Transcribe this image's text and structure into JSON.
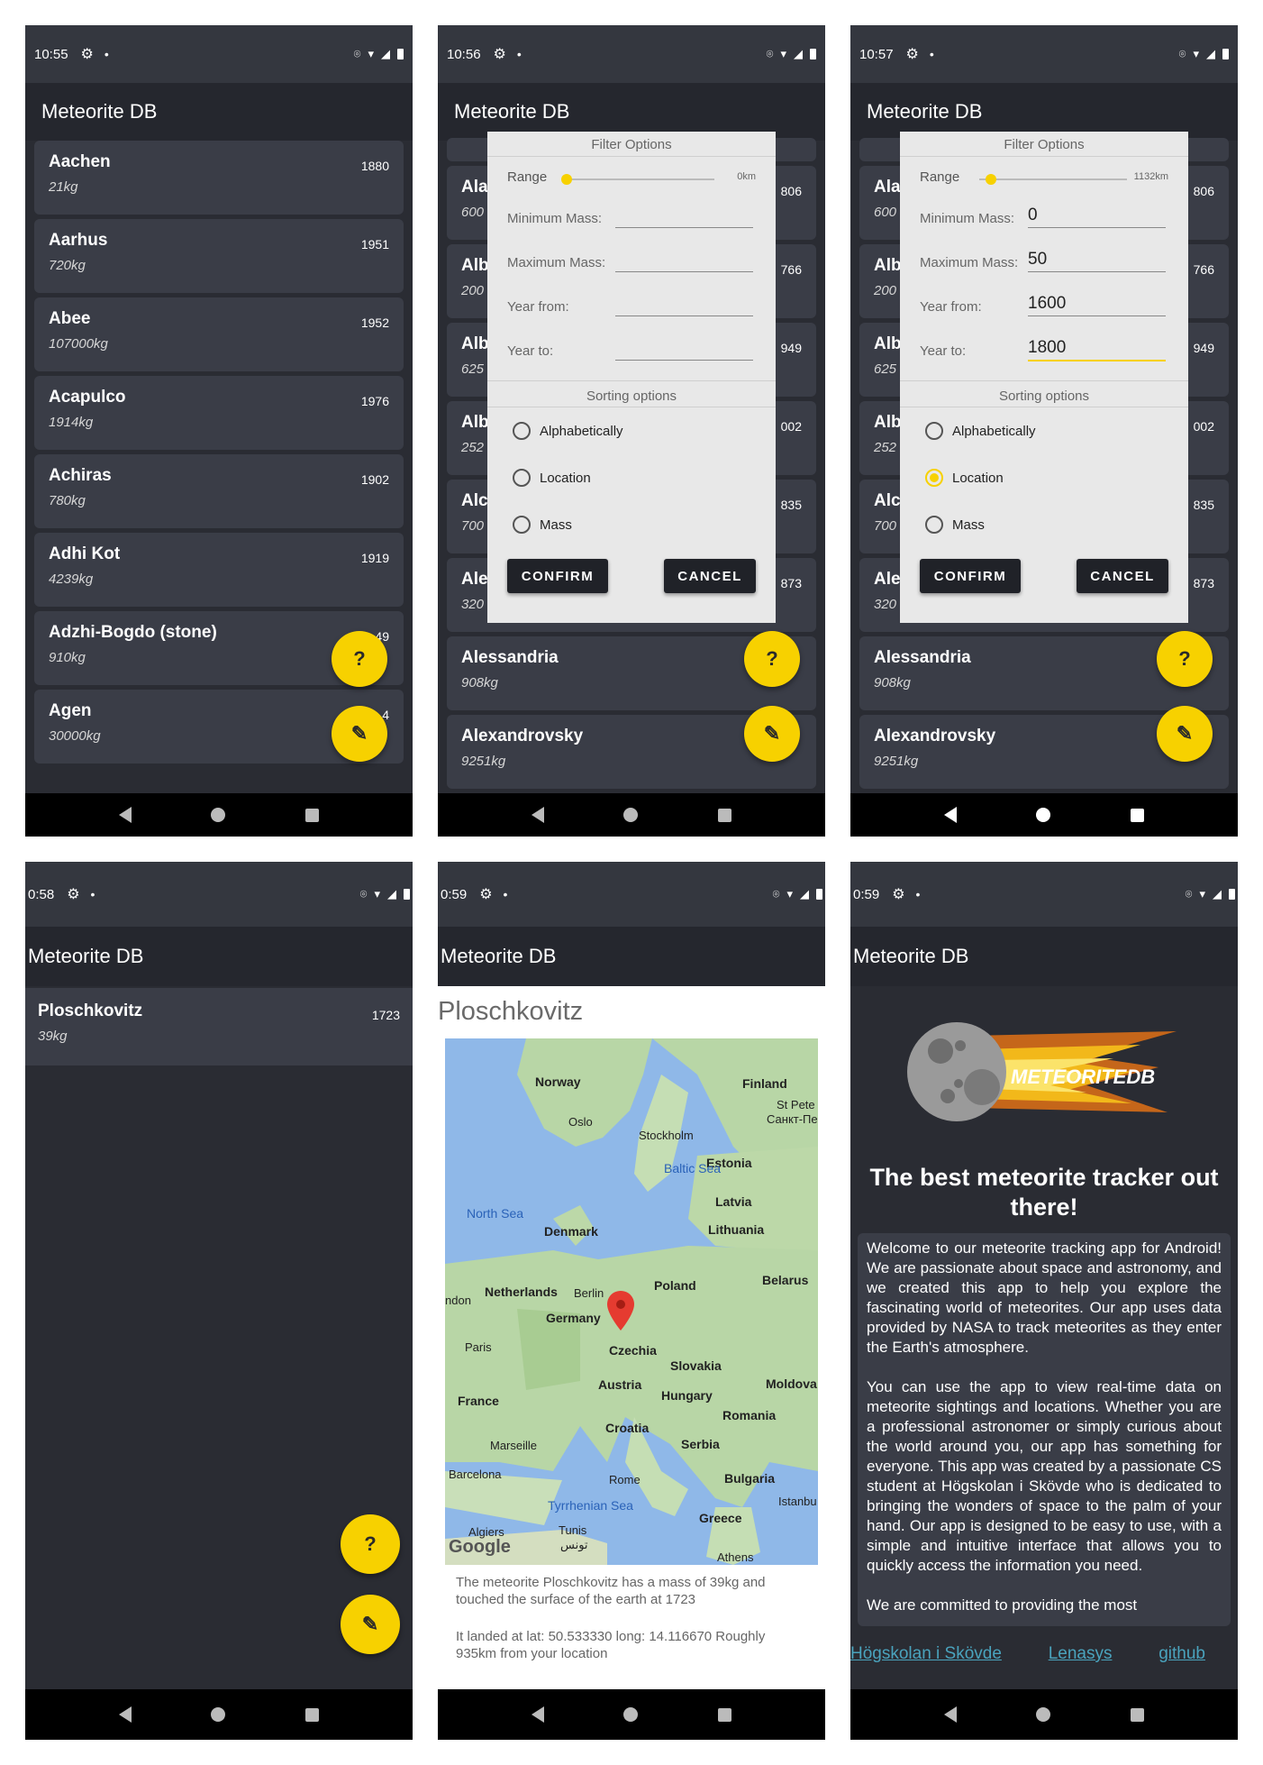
{
  "app_title": "Meteorite DB",
  "status": {
    "s1": "10:55",
    "s2": "10:56",
    "s3": "10:57",
    "s4": "0:58",
    "s5": "0:59",
    "s6": "0:59",
    "gear_icon": "⚙",
    "dot": "•",
    "location_icon": "⌾",
    "wifi_icon": "▾",
    "signal_icon": "◢"
  },
  "list_screen": {
    "items": [
      {
        "name": "Aachen",
        "mass": "21kg",
        "year": "1880"
      },
      {
        "name": "Aarhus",
        "mass": "720kg",
        "year": "1951"
      },
      {
        "name": "Abee",
        "mass": "107000kg",
        "year": "1952"
      },
      {
        "name": "Acapulco",
        "mass": "1914kg",
        "year": "1976"
      },
      {
        "name": "Achiras",
        "mass": "780kg",
        "year": "1902"
      },
      {
        "name": "Adhi Kot",
        "mass": "4239kg",
        "year": "1919"
      },
      {
        "name": "Adzhi-Bogdo (stone)",
        "mass": "910kg",
        "year": "49"
      },
      {
        "name": "Agen",
        "mass": "30000kg",
        "year": "4"
      }
    ],
    "help_fab": "?",
    "edit_fab": "✎"
  },
  "filter_screen": {
    "bg_items": [
      {
        "name": "Ala",
        "mass": "600",
        "year": "806"
      },
      {
        "name": "Alb",
        "mass": "200",
        "year": "766"
      },
      {
        "name": "Alb",
        "mass": "625",
        "year": "949"
      },
      {
        "name": "Alb",
        "mass": "252",
        "year": "002"
      },
      {
        "name": "Alc",
        "mass": "700",
        "year": "835"
      },
      {
        "name": "Ale",
        "mass": "320",
        "year": "873"
      },
      {
        "name": "Alessandria",
        "mass": "908kg",
        "year": ""
      },
      {
        "name": "Alexandrovsky",
        "mass": "9251kg",
        "year": ""
      }
    ],
    "header": "Filter Options",
    "range_label": "Range",
    "range_value_a": "0km",
    "range_value_b": "1132km",
    "range_fraction_a": 0.0,
    "range_fraction_b": 0.08,
    "min_mass_label": "Minimum Mass:",
    "max_mass_label": "Maximum Mass:",
    "year_from_label": "Year from:",
    "year_to_label": "Year to:",
    "min_mass_value": "0",
    "max_mass_value": "50",
    "year_from_value": "1600",
    "year_to_value": "1800",
    "sorting_header": "Sorting options",
    "opt_alpha": "Alphabetically",
    "opt_location": "Location",
    "opt_mass": "Mass",
    "confirm": "CONFIRM",
    "cancel": "CANCEL"
  },
  "result_screen": {
    "item": {
      "name": "Ploschkovitz",
      "mass": "39kg",
      "year": "1723"
    }
  },
  "detail_screen": {
    "title": "Ploschkovitz",
    "map_labels": {
      "norway": "Norway",
      "finland": "Finland",
      "oslo": "Oslo",
      "stockholm": "Stockholm",
      "st_pete": "St Pete",
      "st_pete_ru": "Санкт-Пе",
      "estonia": "Estonia",
      "baltic": "Baltic Sea",
      "latvia": "Latvia",
      "north_sea": "North Sea",
      "denmark": "Denmark",
      "lithuania": "Lithuania",
      "netherlands": "Netherlands",
      "berlin": "Berlin",
      "poland": "Poland",
      "belarus": "Belarus",
      "london": "ndon",
      "germany": "Germany",
      "paris": "Paris",
      "czechia": "Czechia",
      "slovakia": "Slovakia",
      "moldova": "Moldova",
      "austria": "Austria",
      "hungary": "Hungary",
      "france": "France",
      "romania": "Romania",
      "croatia": "Croatia",
      "marseille": "Marseille",
      "serbia": "Serbia",
      "barcelona": "Barcelona",
      "rome": "Rome",
      "bulgaria": "Bulgaria",
      "tyrrhenian": "Tyrrhenian Sea",
      "istanbul": "Istanbu",
      "greece": "Greece",
      "algiers": "Algiers",
      "tunis": "Tunis",
      "tunis_ar": "تونس",
      "athens": "Athens",
      "google": "Google"
    },
    "text1": "The meteorite Ploschkovitz has a mass of 39kg and touched the surface of the earth at 1723",
    "text2": "It landed at lat: 50.533330 long: 14.116670 Roughly 935km from your location"
  },
  "about_screen": {
    "logo_text": "METEORITEDB",
    "headline": "The best meteorite tracker out there!",
    "para1": "Welcome to our meteorite tracking app for Android! We are passionate about space and astronomy, and we created this app to help you explore the fascinating world of meteorites. Our app uses data provided by NASA to track meteorites as they enter the Earth's atmosphere.",
    "para2": "You can use the app to view real-time data on meteorite sightings and locations. Whether you are a professional astronomer or simply curious about the world around you, our app has something for everyone. This app was created by a passionate CS student at Högskolan i Skövde who is dedicated to bringing the wonders of space to the palm of your hand. Our app is designed to be easy to use, with a simple and intuitive interface that allows you to quickly access the information you need.",
    "para3": "We are committed to providing the most",
    "link1": "Högskolan i Skövde",
    "link2": "Lenasys",
    "link3": "github"
  },
  "colors": {
    "accent": "#f7d100",
    "background": "#2a2c33",
    "card": "#3a3d47",
    "appbar": "#25272e",
    "link": "#4aa3bd"
  }
}
